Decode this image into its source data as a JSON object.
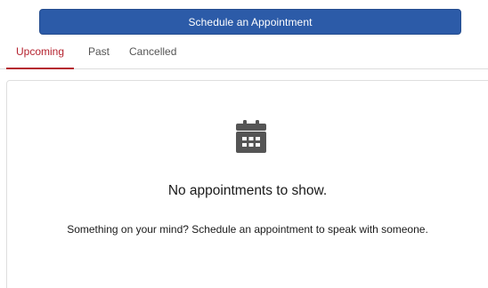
{
  "actions": {
    "schedule_label": "Schedule an Appointment"
  },
  "tabs": [
    {
      "label": "Upcoming",
      "active": true
    },
    {
      "label": "Past",
      "active": false
    },
    {
      "label": "Cancelled",
      "active": false
    }
  ],
  "empty_state": {
    "icon": "calendar-icon",
    "title": "No appointments to show.",
    "message": "Something on your mind? Schedule an appointment to speak with someone."
  },
  "colors": {
    "primary_button": "#2c5ba8",
    "active_tab": "#b5232f",
    "icon": "#555555"
  }
}
